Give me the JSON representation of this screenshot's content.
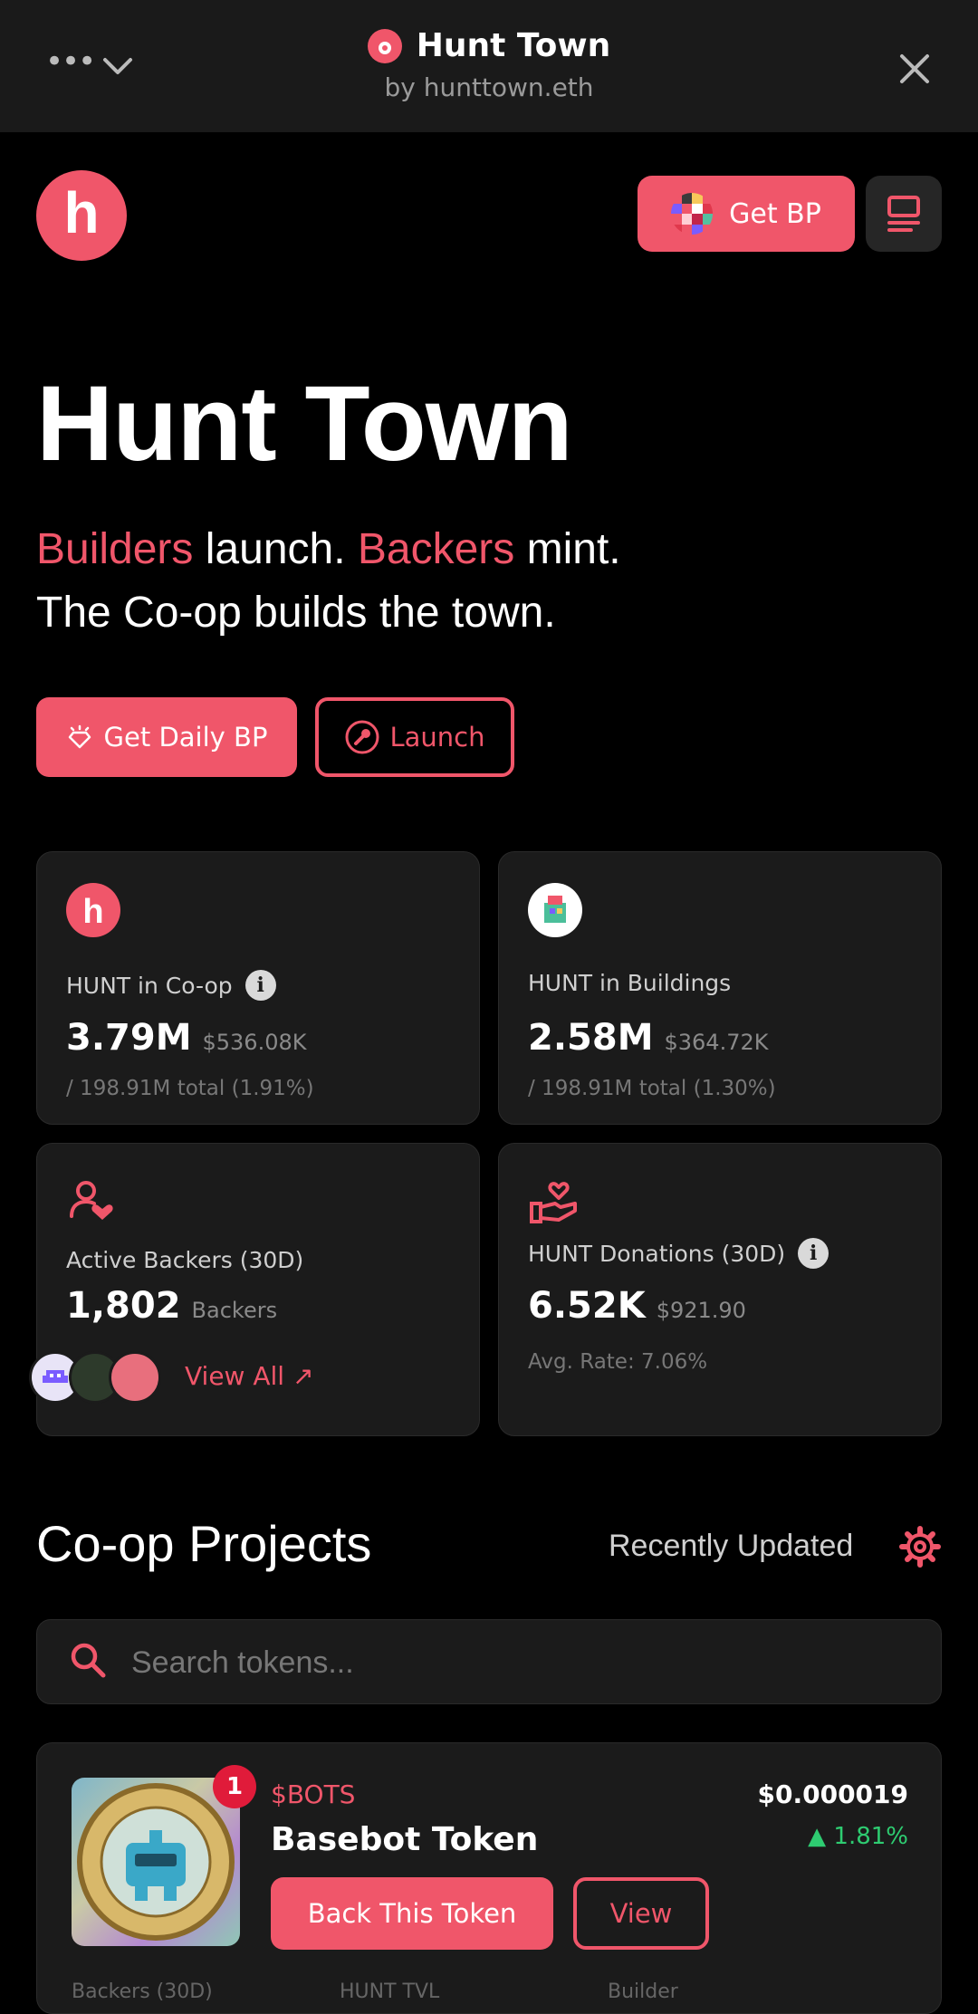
{
  "topbar": {
    "title": "Hunt Town",
    "subtitle": "by hunttown.eth",
    "more_icon": "more-dots-icon",
    "chevron_icon": "chevron-down-icon",
    "close_icon": "close-icon"
  },
  "header": {
    "logo_letter": "h",
    "get_bp_label": "Get BP",
    "menu_icon": "menu-icon"
  },
  "hero": {
    "title": "Hunt Town",
    "tagline_builders": "Builders",
    "tagline_launch": " launch. ",
    "tagline_backers": "Backers",
    "tagline_mint": " mint.",
    "tagline_line2": "The Co-op builds the town.",
    "daily_bp_label": "Get Daily BP",
    "launch_label": "Launch"
  },
  "stats": {
    "coop": {
      "label": "HUNT in Co-op",
      "value": "3.79M",
      "usd": "$536.08K",
      "sub": "/ 198.91M total (1.91%)"
    },
    "buildings": {
      "label": "HUNT in Buildings",
      "value": "2.58M",
      "usd": "$364.72K",
      "sub": "/ 198.91M total (1.30%)"
    },
    "backers": {
      "label": "Active Backers (30D)",
      "value": "1,802",
      "unit": "Backers",
      "view_all": "View All ↗"
    },
    "donations": {
      "label": "HUNT Donations (30D)",
      "value": "6.52K",
      "usd": "$921.90",
      "sub": "Avg. Rate: 7.06%"
    }
  },
  "projects": {
    "title": "Co-op Projects",
    "sort_label": "Recently Updated",
    "search_placeholder": "Search tokens...",
    "tokens": [
      {
        "badge": "1",
        "ticker": "$BOTS",
        "name": "Basebot Token",
        "price": "$0.000019",
        "change": "▲ 1.81%",
        "back_label": "Back This Token",
        "view_label": "View",
        "footer": [
          "Backers (30D)",
          "HUNT TVL",
          "Builder"
        ]
      }
    ]
  },
  "colors": {
    "accent": "#f0566a",
    "positive": "#2ecc71",
    "background": "#000000",
    "card": "#1b1b1b"
  }
}
